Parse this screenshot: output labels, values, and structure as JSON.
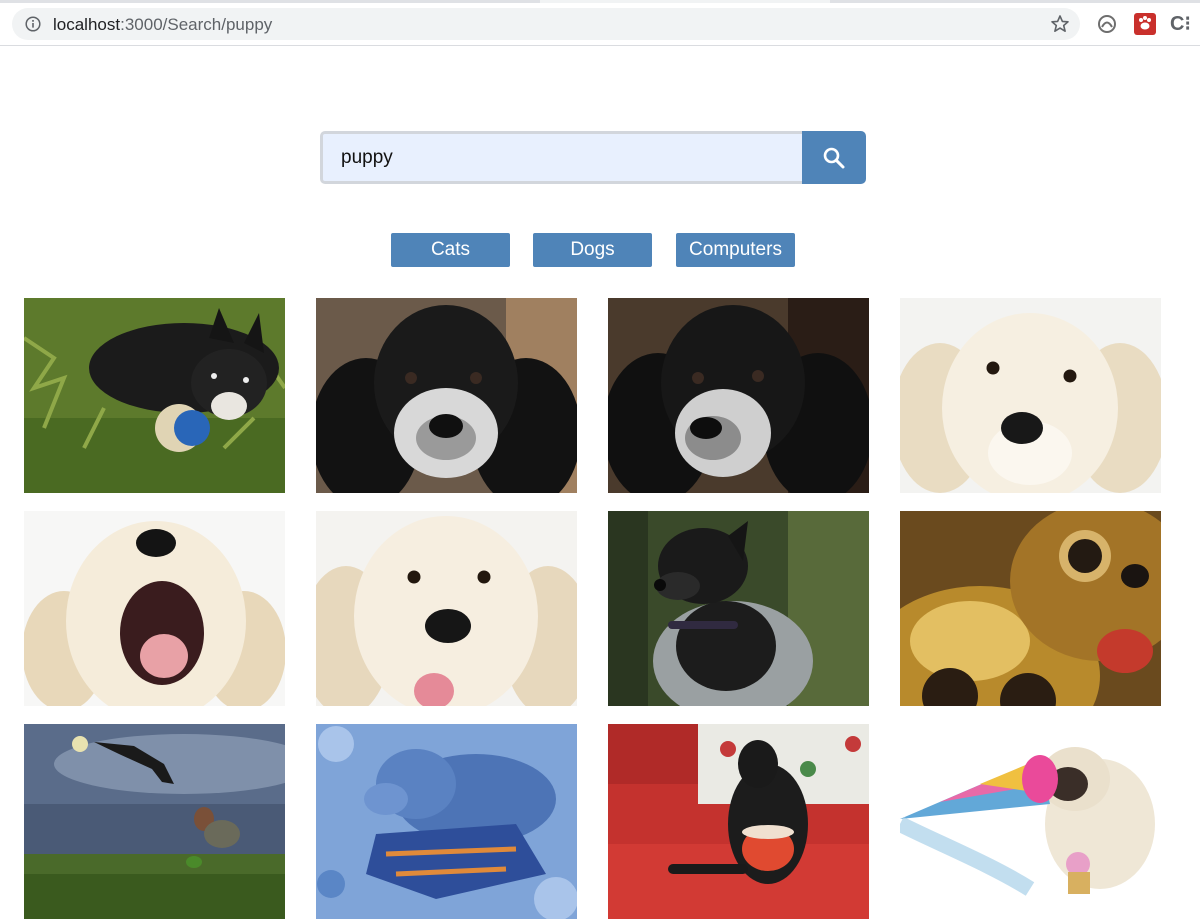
{
  "browser": {
    "url_host": "localhost",
    "url_path": ":3000/Search/puppy"
  },
  "search": {
    "value": "puppy"
  },
  "tags": [
    "Cats",
    "Dogs",
    "Computers"
  ],
  "photos": [
    "puppy-with-ball-on-grass",
    "black-white-spaniel-portrait",
    "black-white-spaniel-portrait-dark",
    "golden-retriever-puppy-face",
    "golden-puppy-yawning",
    "golden-puppy-tongue-out",
    "black-spotted-dog-outdoors",
    "golden-toy-dog-closeup",
    "dog-jumping-for-frisbee-field",
    "blue-tinted-dog-on-rocks",
    "greyhound-on-red-couch-with-mug",
    "pug-with-party-hat"
  ]
}
